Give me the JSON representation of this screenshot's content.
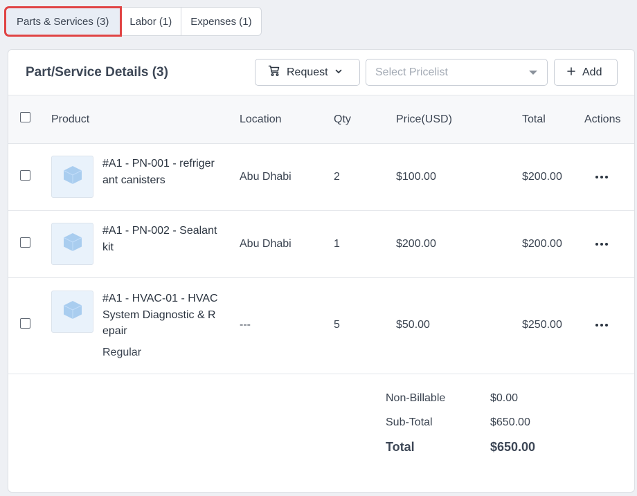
{
  "tabs": [
    {
      "label": "Parts & Services (3)",
      "active": true
    },
    {
      "label": "Labor (1)",
      "active": false
    },
    {
      "label": "Expenses (1)",
      "active": false
    }
  ],
  "card": {
    "title": "Part/Service Details (3)",
    "request_label": "Request",
    "pricelist_placeholder": "Select Pricelist",
    "add_label": "Add"
  },
  "table": {
    "headers": {
      "product": "Product",
      "location": "Location",
      "qty": "Qty",
      "price": "Price(USD)",
      "total": "Total",
      "actions": "Actions"
    },
    "rows": [
      {
        "name": "#A1 - PN-001 - refrigerant canisters",
        "sub": "",
        "location": "Abu Dhabi",
        "qty": "2",
        "price": "$100.00",
        "total": "$200.00"
      },
      {
        "name": "#A1 - PN-002 - Sealant kit",
        "sub": "",
        "location": "Abu Dhabi",
        "qty": "1",
        "price": "$200.00",
        "total": "$200.00"
      },
      {
        "name": "#A1 - HVAC-01 - HVAC System Diagnostic & Repair",
        "sub": "Regular",
        "location": "---",
        "qty": "5",
        "price": "$50.00",
        "total": "$250.00"
      }
    ]
  },
  "summary": {
    "non_billable_label": "Non-Billable",
    "non_billable_value": "$0.00",
    "subtotal_label": "Sub-Total",
    "subtotal_value": "$650.00",
    "total_label": "Total",
    "total_value": "$650.00"
  },
  "colors": {
    "active_tab_outline": "#e04444",
    "thumb_bg": "#e9f2fb",
    "cube": "#a9cdef"
  },
  "icons": {
    "request": "cart-icon",
    "request_caret": "chevron-down-icon",
    "add": "plus-icon",
    "row_actions": "more-horizontal-icon",
    "thumbnail": "cube-icon"
  }
}
